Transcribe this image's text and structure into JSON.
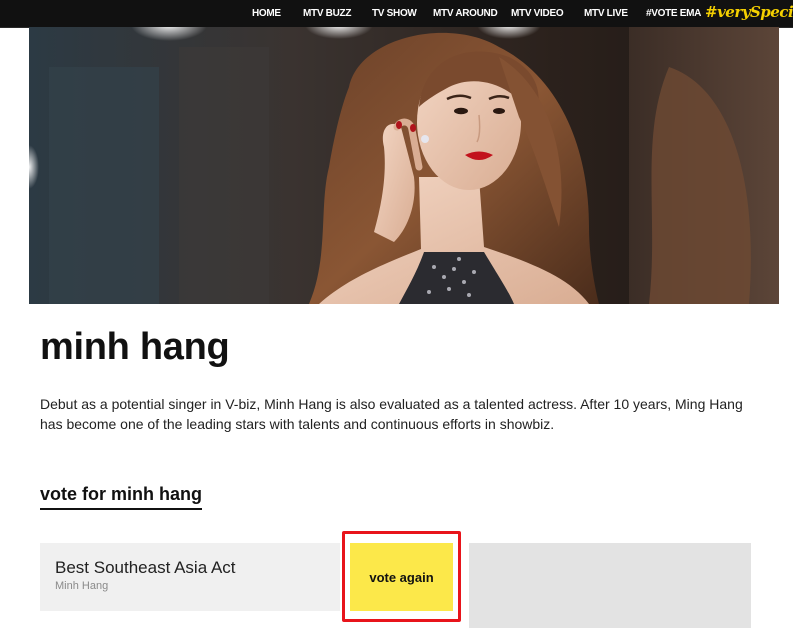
{
  "nav": {
    "items": [
      "HOME",
      "MTV BUZZ",
      "TV SHOW",
      "MTV AROUND",
      "MTV VIDEO",
      "MTV LIVE",
      "#VOTE EMA"
    ],
    "special": "#verySpecial"
  },
  "artist": {
    "name": "minh hang",
    "bio": "Debut as a potential singer in V-biz, Minh Hang is also evaluated as a talented actress. After 10 years, Ming Hang has become one of the leading stars with talents and continuous efforts in showbiz.",
    "vote_heading": "vote for minh hang"
  },
  "vote_card": {
    "category": "Best Southeast Asia Act",
    "nominee": "Minh Hang",
    "button_label": "vote again"
  },
  "colors": {
    "nav_bg": "#111111",
    "special_accent": "#f5d000",
    "vote_button": "#fce84a",
    "highlight_frame": "#e8141b"
  }
}
